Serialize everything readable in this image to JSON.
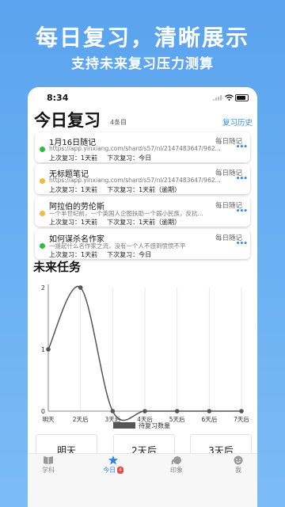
{
  "promo": {
    "title": "每日复习，清晰展示",
    "subtitle": "支持未来复习压力测算"
  },
  "status": {
    "time": "8:34"
  },
  "header": {
    "title": "今日复习",
    "count": "4条目",
    "history_link": "复习历史"
  },
  "colors": {
    "accent": "#3b8be4",
    "green": "#2ebd3a",
    "yellow": "#f4b93a"
  },
  "cards": [
    {
      "title": "1月16日随记",
      "tag": "每日随记",
      "status": "green",
      "desc": "https://app.yinxiang.com/shard/s57/nl/2147483647/962...",
      "last": "上次复习：1天前",
      "next": "下次复习：今日"
    },
    {
      "title": "无标题笔记",
      "tag": "每日随记",
      "status": "yellow",
      "desc": "https://app.yinxiang.com/shard/s57/nl/2147483647/962...",
      "last": "上次复习：1天前",
      "next": "下次复习：1天前（逾期）"
    },
    {
      "title": "阿拉伯的劳伦斯",
      "tag": "每日随记",
      "status": "yellow",
      "desc": "一个半世纪前，一个英国人企图扶助一个弱小民族，反抗...",
      "last": "上次复习：1天前",
      "next": "下次复习：1天前（逾期）"
    },
    {
      "title": "如何谋杀名作家",
      "tag": "每日随记",
      "status": "green",
      "desc": "一提起什么名作家之流，没有一个人不感到愤愤不平",
      "last": "上次复习：1天前",
      "next": "下次复习：今日"
    }
  ],
  "future": {
    "title": "未来任务"
  },
  "chart_data": {
    "type": "line",
    "categories": [
      "明天",
      "2天后",
      "3天后",
      "4天后",
      "5天后",
      "6天后",
      "7天后"
    ],
    "series": [
      {
        "name": "待复习数量",
        "values": [
          1,
          2,
          0,
          0,
          0,
          0,
          0
        ]
      }
    ],
    "ylim": [
      0,
      2
    ],
    "yticks": [
      "0",
      "1",
      "2"
    ],
    "legend": "bottom"
  },
  "day_buttons": [
    "明天",
    "2天后",
    "3天后"
  ],
  "tabs": [
    {
      "label": "学科",
      "icon": "book-icon"
    },
    {
      "label": "今日",
      "icon": "star-icon",
      "badge": "4"
    },
    {
      "label": "印象",
      "icon": "elephant-icon"
    },
    {
      "label": "我",
      "icon": "profile-icon"
    }
  ]
}
